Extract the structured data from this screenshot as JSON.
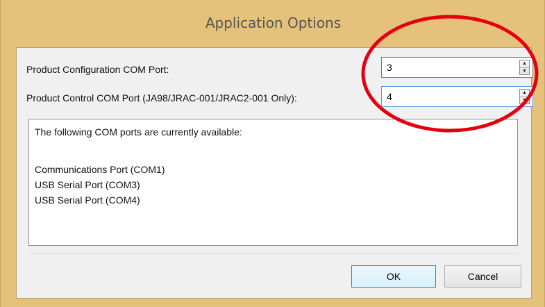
{
  "window": {
    "title": "Application Options"
  },
  "fields": {
    "config_port": {
      "label": "Product Configuration COM Port:",
      "value": "3"
    },
    "control_port": {
      "label": "Product Control COM Port (JA98/JRAC-001/JRAC2-001 Only):",
      "value": "4"
    }
  },
  "available_ports": {
    "header": "The following COM ports are currently available:",
    "items": [
      "Communications Port (COM1)",
      "USB Serial Port (COM3)",
      "USB Serial Port (COM4)"
    ]
  },
  "buttons": {
    "ok_label": "OK",
    "cancel_label": "Cancel"
  },
  "colors": {
    "title_bar": "#e5c27c",
    "annotation_circle": "#e3000f",
    "focus_border": "#569de5"
  },
  "icons": {
    "spin_up": "triangle-up",
    "spin_down": "triangle-down"
  }
}
